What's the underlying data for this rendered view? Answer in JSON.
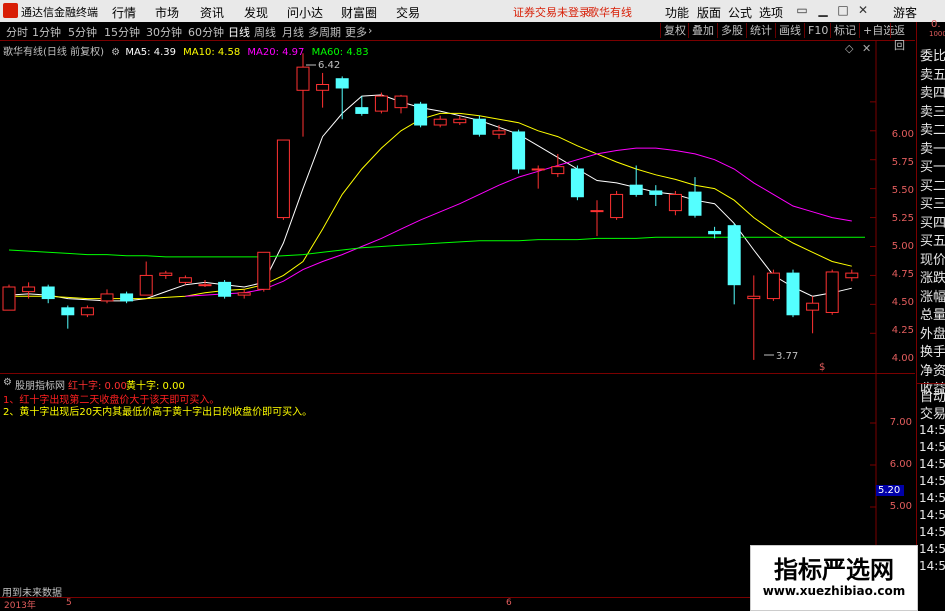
{
  "titlebar": {
    "app_title": "通达信金融终端",
    "menu": [
      "行情",
      "市场",
      "资讯",
      "发现",
      "问小达",
      "财富圈",
      "交易"
    ],
    "status": "证券交易未登录",
    "stock": "歌华有线",
    "right_menu": [
      "功能",
      "版面",
      "公式",
      "选项"
    ],
    "user": "游客"
  },
  "periods": [
    "分时",
    "1分钟",
    "5分钟",
    "15分钟",
    "30分钟",
    "60分钟",
    "日线",
    "周线",
    "月线",
    "多周期",
    "更多"
  ],
  "active_period": "日线",
  "toolbar_right": [
    "复权",
    "叠加",
    "多股",
    "统计",
    "画线",
    "F10",
    "标记",
    "+自选",
    "返回"
  ],
  "main": {
    "stock_label": "歌华有线(日线 前复权)",
    "ma": [
      {
        "label": "MA5: 4.39",
        "color": "#ffffff"
      },
      {
        "label": "MA10: 4.58",
        "color": "#ffff00"
      },
      {
        "label": "MA20: 4.97",
        "color": "#ff00ff"
      },
      {
        "label": "MA60: 4.83",
        "color": "#00ff00"
      }
    ],
    "high_label": "6.42",
    "low_label": "3.77",
    "marker": "$",
    "y_labels": [
      "6.00",
      "5.75",
      "5.50",
      "5.25",
      "5.00",
      "4.75",
      "4.50",
      "4.25",
      "4.00"
    ]
  },
  "chart_data": {
    "type": "candlestick",
    "ylim": [
      3.7,
      6.5
    ],
    "candles": [
      {
        "o": 4.2,
        "c": 4.4,
        "h": 4.42,
        "l": 4.2
      },
      {
        "o": 4.36,
        "c": 4.4,
        "h": 4.44,
        "l": 4.3
      },
      {
        "o": 4.4,
        "c": 4.3,
        "h": 4.42,
        "l": 4.26
      },
      {
        "o": 4.22,
        "c": 4.16,
        "h": 4.24,
        "l": 4.04
      },
      {
        "o": 4.16,
        "c": 4.22,
        "h": 4.24,
        "l": 4.14
      },
      {
        "o": 4.28,
        "c": 4.34,
        "h": 4.38,
        "l": 4.26
      },
      {
        "o": 4.34,
        "c": 4.28,
        "h": 4.36,
        "l": 4.26
      },
      {
        "o": 4.33,
        "c": 4.5,
        "h": 4.62,
        "l": 4.33
      },
      {
        "o": 4.5,
        "c": 4.52,
        "h": 4.54,
        "l": 4.47
      },
      {
        "o": 4.44,
        "c": 4.48,
        "h": 4.5,
        "l": 4.42
      },
      {
        "o": 4.42,
        "c": 4.42,
        "h": 4.46,
        "l": 4.4
      },
      {
        "o": 4.44,
        "c": 4.32,
        "h": 4.46,
        "l": 4.3
      },
      {
        "o": 4.33,
        "c": 4.35,
        "h": 4.38,
        "l": 4.3
      },
      {
        "o": 4.38,
        "c": 4.7,
        "h": 4.7,
        "l": 4.36
      },
      {
        "o": 5.0,
        "c": 5.67,
        "h": 5.67,
        "l": 4.98
      },
      {
        "o": 6.1,
        "c": 6.3,
        "h": 6.42,
        "l": 5.7
      },
      {
        "o": 6.1,
        "c": 6.15,
        "h": 6.25,
        "l": 5.95
      },
      {
        "o": 6.2,
        "c": 6.12,
        "h": 6.22,
        "l": 5.85
      },
      {
        "o": 5.95,
        "c": 5.9,
        "h": 6.05,
        "l": 5.88
      },
      {
        "o": 5.92,
        "c": 6.05,
        "h": 6.08,
        "l": 5.9
      },
      {
        "o": 5.95,
        "c": 6.05,
        "h": 6.06,
        "l": 5.9
      },
      {
        "o": 5.98,
        "c": 5.8,
        "h": 6.0,
        "l": 5.78
      },
      {
        "o": 5.8,
        "c": 5.85,
        "h": 5.88,
        "l": 5.78
      },
      {
        "o": 5.82,
        "c": 5.85,
        "h": 5.88,
        "l": 5.8
      },
      {
        "o": 5.85,
        "c": 5.72,
        "h": 5.88,
        "l": 5.7
      },
      {
        "o": 5.72,
        "c": 5.75,
        "h": 5.8,
        "l": 5.68
      },
      {
        "o": 5.74,
        "c": 5.42,
        "h": 5.76,
        "l": 5.38
      },
      {
        "o": 5.42,
        "c": 5.42,
        "h": 5.45,
        "l": 5.25
      },
      {
        "o": 5.38,
        "c": 5.44,
        "h": 5.55,
        "l": 5.35
      },
      {
        "o": 5.42,
        "c": 5.18,
        "h": 5.45,
        "l": 5.15
      },
      {
        "o": 5.06,
        "c": 5.06,
        "h": 5.15,
        "l": 4.84
      },
      {
        "o": 5.0,
        "c": 5.2,
        "h": 5.23,
        "l": 4.98
      },
      {
        "o": 5.28,
        "c": 5.2,
        "h": 5.45,
        "l": 5.18
      },
      {
        "o": 5.23,
        "c": 5.2,
        "h": 5.28,
        "l": 5.1
      },
      {
        "o": 5.06,
        "c": 5.2,
        "h": 5.23,
        "l": 5.02
      },
      {
        "o": 5.22,
        "c": 5.02,
        "h": 5.35,
        "l": 5.0
      },
      {
        "o": 4.88,
        "c": 4.86,
        "h": 4.92,
        "l": 4.82
      },
      {
        "o": 4.93,
        "c": 4.42,
        "h": 4.95,
        "l": 4.25
      },
      {
        "o": 4.3,
        "c": 4.32,
        "h": 4.5,
        "l": 3.77
      },
      {
        "o": 4.3,
        "c": 4.52,
        "h": 4.55,
        "l": 4.28
      },
      {
        "o": 4.52,
        "c": 4.16,
        "h": 4.55,
        "l": 4.14
      },
      {
        "o": 4.2,
        "c": 4.26,
        "h": 4.32,
        "l": 4.0
      },
      {
        "o": 4.18,
        "c": 4.53,
        "h": 4.55,
        "l": 4.16
      },
      {
        "o": 4.48,
        "c": 4.52,
        "h": 4.55,
        "l": 4.45
      }
    ],
    "series": [
      {
        "name": "MA5",
        "color": "#ffffff",
        "values": [
          4.33,
          4.34,
          4.33,
          4.3,
          4.29,
          4.28,
          4.28,
          4.3,
          4.36,
          4.42,
          4.44,
          4.42,
          4.4,
          4.44,
          4.78,
          5.25,
          5.7,
          5.9,
          6.05,
          6.06,
          6.0,
          5.95,
          5.92,
          5.88,
          5.84,
          5.78,
          5.72,
          5.62,
          5.52,
          5.42,
          5.32,
          5.3,
          5.26,
          5.22,
          5.2,
          5.15,
          5.12,
          4.95,
          4.72,
          4.5,
          4.4,
          4.32,
          4.35,
          4.39
        ]
      },
      {
        "name": "MA10",
        "color": "#ffff00",
        "values": [
          4.32,
          4.32,
          4.32,
          4.31,
          4.3,
          4.3,
          4.3,
          4.3,
          4.31,
          4.32,
          4.35,
          4.37,
          4.38,
          4.42,
          4.5,
          4.62,
          4.9,
          5.2,
          5.42,
          5.6,
          5.75,
          5.85,
          5.9,
          5.9,
          5.88,
          5.85,
          5.82,
          5.75,
          5.7,
          5.62,
          5.55,
          5.48,
          5.42,
          5.37,
          5.33,
          5.28,
          5.25,
          5.15,
          5.0,
          4.88,
          4.78,
          4.7,
          4.62,
          4.58
        ]
      },
      {
        "name": "MA20",
        "color": "#ff00ff",
        "values": [
          null,
          null,
          null,
          null,
          null,
          null,
          null,
          null,
          null,
          4.32,
          4.33,
          4.34,
          4.35,
          4.38,
          4.45,
          4.55,
          4.62,
          4.68,
          4.75,
          4.82,
          4.9,
          4.98,
          5.05,
          5.12,
          5.2,
          5.28,
          5.35,
          5.4,
          5.45,
          5.5,
          5.55,
          5.58,
          5.6,
          5.6,
          5.58,
          5.55,
          5.5,
          5.42,
          5.3,
          5.2,
          5.1,
          5.05,
          5.0,
          4.97
        ]
      },
      {
        "name": "MA60",
        "color": "#00ff00",
        "values": [
          4.72,
          4.71,
          4.7,
          4.69,
          4.68,
          4.68,
          4.67,
          4.67,
          4.66,
          4.66,
          4.66,
          4.66,
          4.66,
          4.66,
          4.67,
          4.68,
          4.7,
          4.72,
          4.74,
          4.75,
          4.76,
          4.77,
          4.78,
          4.79,
          4.8,
          4.8,
          4.8,
          4.81,
          4.81,
          4.81,
          4.82,
          4.82,
          4.82,
          4.83,
          4.83,
          4.83,
          4.83,
          4.83,
          4.83,
          4.83,
          4.83,
          4.83,
          4.83,
          4.83
        ]
      }
    ]
  },
  "indicator": {
    "name": "股朋指标网",
    "red": "红十字: 0.00",
    "yellow": "黄十字: 0.00",
    "note1": "1、红十字出现第二天收盘价大于该天即可买入。",
    "note2": "2、黄十字出现后20天内其最低价高于黄十字出日的收盘价即可买入。",
    "y_labels": [
      "7.00",
      "6.00",
      "5.00"
    ],
    "current_value": "5.20",
    "footer_text": "用到未来数据"
  },
  "timeline": {
    "year": "2013年",
    "m5": "5",
    "m6": "6"
  },
  "rightpanel": {
    "top_code": "0.",
    "top_num": "1000",
    "labels": [
      "委比",
      "卖五",
      "卖四",
      "卖三",
      "卖二",
      "卖一",
      "买一",
      "买二",
      "买三",
      "买四",
      "买五",
      "现价",
      "涨跌",
      "涨幅",
      "总量",
      "外盘",
      "换手",
      "净资",
      "收益"
    ],
    "lower_labels": [
      "自动",
      "交易"
    ],
    "times": [
      "14:5",
      "14:5",
      "14:5",
      "14:5",
      "14:5",
      "14:5",
      "14:5",
      "14:5",
      "14:5"
    ]
  },
  "watermark": {
    "cn": "指标严选网",
    "url": "www.xuezhibiao.com"
  }
}
